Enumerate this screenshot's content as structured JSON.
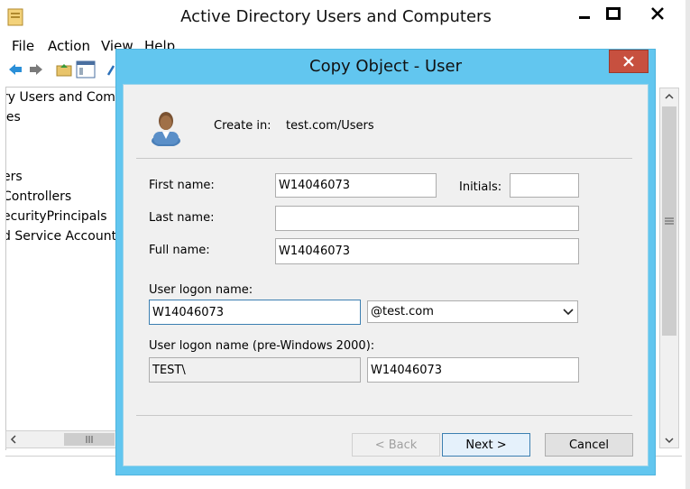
{
  "main_window": {
    "title": "Active Directory Users and Computers",
    "menu": [
      "File",
      "Action",
      "View",
      "Help"
    ],
    "tree_items": [
      "ry Users and Comp",
      "ies",
      "ers",
      "Controllers",
      "ecurityPrincipals",
      "d Service Accounts"
    ]
  },
  "dialog": {
    "title": "Copy Object - User",
    "create_in_label": "Create in:",
    "create_in_value": "test.com/Users",
    "first_name_label": "First name:",
    "first_name_value": "W14046073",
    "initials_label": "Initials:",
    "initials_value": "",
    "last_name_label": "Last name:",
    "last_name_value": "",
    "full_name_label": "Full name:",
    "full_name_value": "W14046073",
    "logon_label": "User logon name:",
    "logon_value": "W14046073",
    "domain_value": "@test.com",
    "pre2000_label": "User logon name (pre-Windows 2000):",
    "pre2000_domain_value": "TEST\\",
    "pre2000_user_value": "W14046073",
    "back_label": "< Back",
    "next_label": "Next >",
    "cancel_label": "Cancel"
  },
  "icons": {
    "app": "folder-app-icon",
    "user": "user-icon"
  },
  "colors": {
    "dialog_frame": "#62c6ef",
    "close_button": "#c7503f"
  }
}
